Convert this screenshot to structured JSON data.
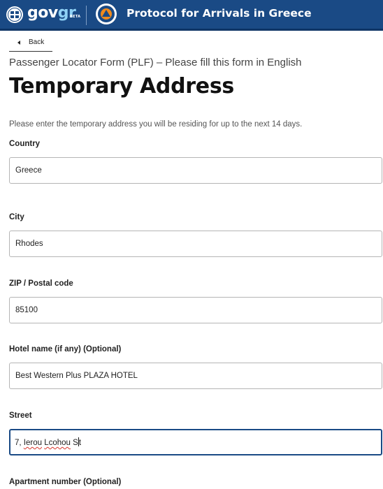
{
  "header": {
    "logo_gov": "gov",
    "logo_gr": "gr",
    "logo_beta": "BETA",
    "title": "Protocol for Arrivals in Greece",
    "brand_color": "#1a4a85"
  },
  "nav": {
    "back_label": "Back"
  },
  "form": {
    "subtitle": "Passenger Locator Form (PLF) – Please fill this form in English",
    "title": "Temporary Address",
    "intro": "Please enter the temporary address you will be residing for up to the next 14 days.",
    "fields": {
      "country": {
        "label": "Country",
        "value": "Greece"
      },
      "city": {
        "label": "City",
        "value": "Rhodes"
      },
      "zip": {
        "label": "ZIP / Postal code",
        "value": "85100"
      },
      "hotel": {
        "label": "Hotel name (if any) (Optional)",
        "value": "Best Western Plus PLAZA HOTEL"
      },
      "street": {
        "label": "Street",
        "value": "7, Ierou Lcohou St",
        "value_parts": [
          "7, ",
          "Ierou",
          " ",
          "Lcohou",
          " S",
          "t"
        ]
      },
      "apartment": {
        "label": "Apartment number (Optional)"
      }
    }
  }
}
